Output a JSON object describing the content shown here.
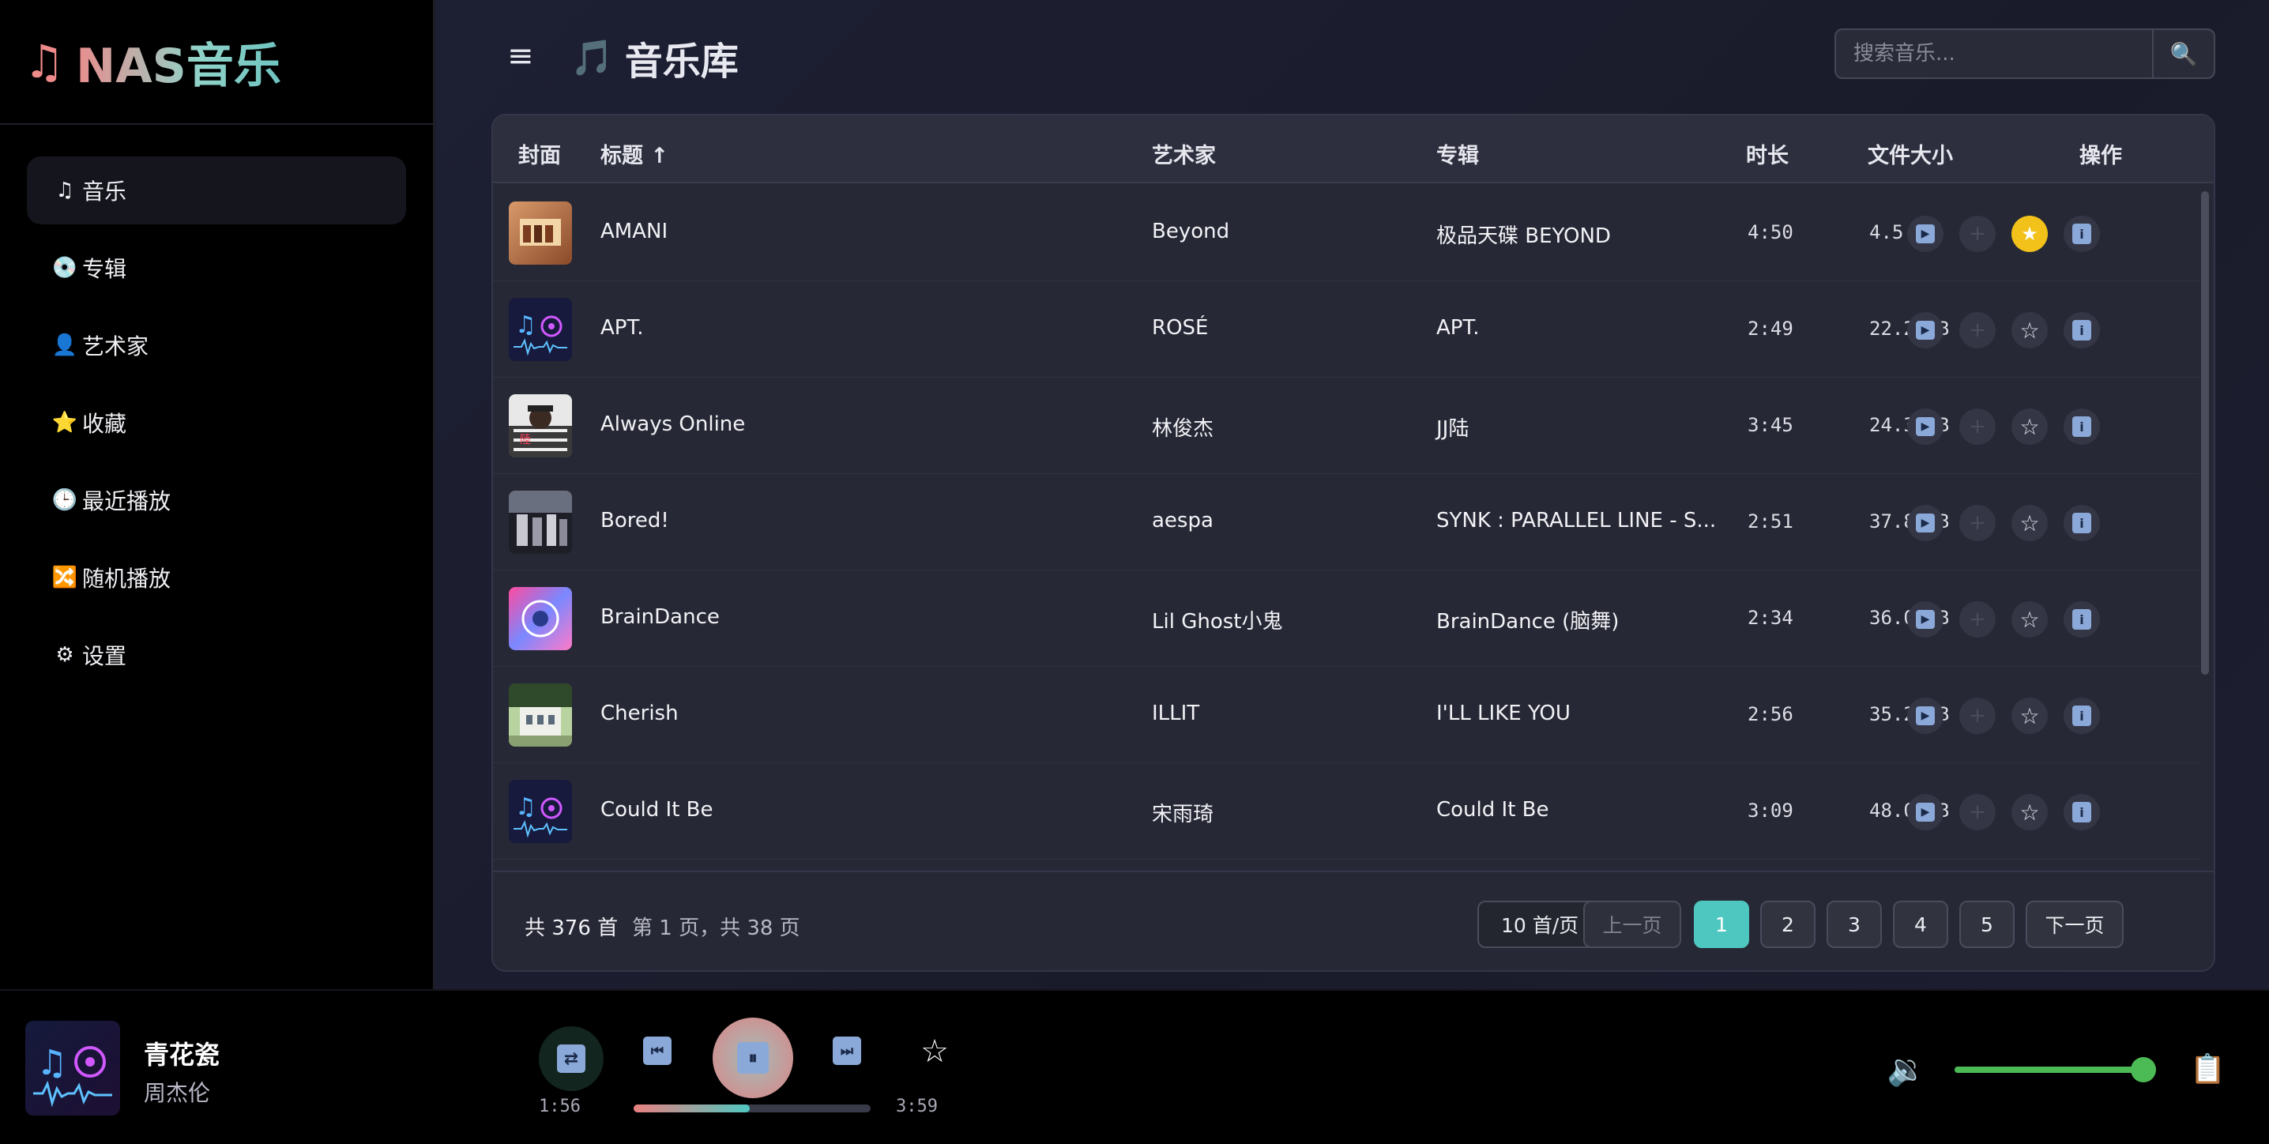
{
  "brand": {
    "icon": "♫",
    "name": "NAS音乐"
  },
  "nav": [
    {
      "icon": "♫",
      "label": "音乐",
      "icon_name": "music-note-icon"
    },
    {
      "icon": "💿",
      "label": "专辑",
      "icon_name": "disc-icon"
    },
    {
      "icon": "👤",
      "label": "艺术家",
      "icon_name": "person-icon"
    },
    {
      "icon": "⭐",
      "label": "收藏",
      "icon_name": "star-icon"
    },
    {
      "icon": "🕒",
      "label": "最近播放",
      "icon_name": "clock-icon"
    },
    {
      "icon": "🔀",
      "label": "随机播放",
      "icon_name": "shuffle-icon"
    },
    {
      "icon": "⚙",
      "label": "设置",
      "icon_name": "gear-icon"
    }
  ],
  "header": {
    "menu_icon": "≡",
    "title_icon": "🎵",
    "title": "音乐库",
    "search_placeholder": "搜索音乐...",
    "search_icon": "🔍"
  },
  "table": {
    "columns": [
      "封面",
      "标题 ↑",
      "艺术家",
      "专辑",
      "时长",
      "文件大小",
      "操作"
    ],
    "rows": [
      {
        "title": "AMANI",
        "artist": "Beyond",
        "album": "极品天碟 BEYOND",
        "duration": "4:50",
        "size": "4.5 MB",
        "favorite": true
      },
      {
        "title": "APT.",
        "artist": "ROSÉ",
        "album": "APT.",
        "duration": "2:49",
        "size": "22.2 MB",
        "favorite": false
      },
      {
        "title": "Always Online",
        "artist": "林俊杰",
        "album": "JJ陆",
        "duration": "3:45",
        "size": "24.3 MB",
        "favorite": false
      },
      {
        "title": "Bored!",
        "artist": "aespa",
        "album": "SYNK : PARALLEL LINE - S...",
        "duration": "2:51",
        "size": "37.8 MB",
        "favorite": false
      },
      {
        "title": "BrainDance",
        "artist": "Lil Ghost小鬼",
        "album": "BrainDance (脑舞)",
        "duration": "2:34",
        "size": "36.0 MB",
        "favorite": false
      },
      {
        "title": "Cherish",
        "artist": "ILLIT",
        "album": "I'LL LIKE YOU",
        "duration": "2:56",
        "size": "35.2 MB",
        "favorite": false
      },
      {
        "title": "Could It Be",
        "artist": "宋雨琦",
        "album": "Could It Be",
        "duration": "3:09",
        "size": "48.0 MB",
        "favorite": false
      }
    ],
    "action_icons": {
      "play": "▶",
      "add": "+",
      "star_off": "☆",
      "star_on": "★",
      "info": "i"
    }
  },
  "footer": {
    "count": "共 376 首",
    "page_info": "第 1 页，共 38 页",
    "per_page": "10 首/页",
    "prev": "上一页",
    "pages": [
      "1",
      "2",
      "3",
      "4",
      "5"
    ],
    "next": "下一页"
  },
  "player": {
    "title": "青花瓷",
    "artist": "周杰伦",
    "current_time": "1:56",
    "total_time": "3:59",
    "progress": 0.49,
    "volume": 0.98,
    "icons": {
      "shuffle": "⇄",
      "prev": "⏮",
      "pause": "⏸",
      "next": "⏭",
      "star": "☆",
      "volume": "🔉",
      "playlist": "📋"
    }
  },
  "colors": {
    "accent": "#4ec7c0",
    "favorite": "#f2c21a",
    "progress_start": "#e98080",
    "progress_end": "#4ec7c0",
    "volume": "#4cbb55"
  }
}
